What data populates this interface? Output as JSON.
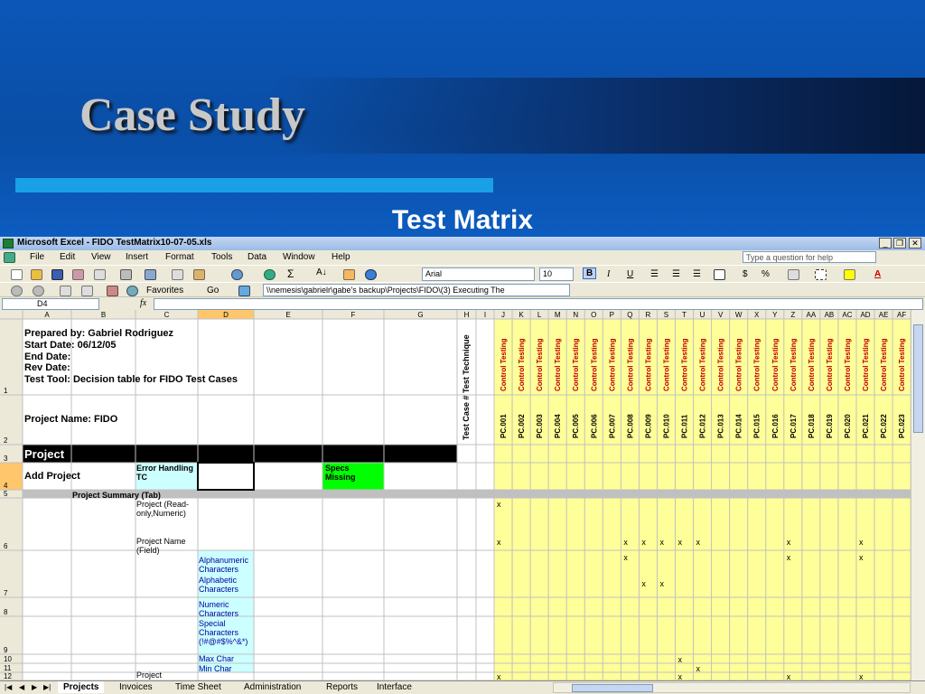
{
  "slide": {
    "title": "Case Study",
    "subtitle": "Test Matrix"
  },
  "window": {
    "title": "Microsoft Excel - FIDO  TestMatrix10-07-05.xls",
    "controls": [
      "_",
      "❐",
      "✕"
    ]
  },
  "menu": {
    "items": [
      "File",
      "Edit",
      "View",
      "Insert",
      "Format",
      "Tools",
      "Data",
      "Window",
      "Help"
    ],
    "question_placeholder": "Type a question for help"
  },
  "format_toolbar": {
    "font": "Arial",
    "size": "10",
    "bold": "B",
    "italic": "I",
    "underline": "U",
    "currency": "$",
    "percent": "%"
  },
  "web_toolbar": {
    "favorites": "Favorites",
    "go": "Go",
    "address": "\\\\nemesis\\gabrielr\\gabe's backup\\Projects\\FIDO\\(3) Executing The"
  },
  "formula_bar": {
    "name_box": "D4",
    "fx": "fx",
    "value": ""
  },
  "grid": {
    "left_columns": [
      "A",
      "B",
      "C",
      "D",
      "E",
      "F",
      "G",
      "H"
    ],
    "right_columns": [
      "I",
      "J",
      "K",
      "L",
      "M",
      "N",
      "O",
      "P",
      "Q",
      "R",
      "S",
      "T",
      "U",
      "V",
      "W",
      "X",
      "Y",
      "Z",
      "AA",
      "AB",
      "AC",
      "AD",
      "AE",
      "AF"
    ],
    "row_numbers": [
      "1",
      "2",
      "3",
      "4",
      "5",
      "6",
      "7",
      "8",
      "9",
      "10",
      "11",
      "12",
      "13"
    ],
    "header_lines": [
      "Prepared by: Gabriel Rodriguez",
      "Start Date: 06/12/05",
      "End Date:",
      "Rev Date:",
      "Test Tool: Decision table for FIDO Test Cases"
    ],
    "project_name": "Project Name: FIDO",
    "test_technique_label": "Test Technique",
    "test_case_label": "Test Case #",
    "technique_value": "Control Testing",
    "test_cases": [
      "PC.001",
      "PC.002",
      "PC.003",
      "PC.004",
      "PC.005",
      "PC.006",
      "PC.007",
      "PC.008",
      "PC.009",
      "PC.010",
      "PC.011",
      "PC.012",
      "PC.013",
      "PC.014",
      "PC.015",
      "PC.016",
      "PC.017",
      "PC.018",
      "PC.019",
      "PC.020",
      "PC.021",
      "PC.022",
      "PC.023"
    ],
    "project_header": "Project",
    "add_project": "Add Project",
    "error_handling": "Error Handling TC",
    "specs_missing": "Specs Missing",
    "summary_row": "Project Summary (Tab)",
    "field_project_readonly": "Project (Read-only,Numeric)",
    "field_project_name": "Project Name (Field)",
    "field_alphanumeric": "Alphanumeric Characters",
    "field_alphabetic": "Alphabetic Characters",
    "field_numeric": "Numeric Characters",
    "field_special": "Special Characters (!#@#$%^&*)",
    "field_max_char": "Max Char",
    "field_min_char": "Min Char",
    "field_project_last": "Project",
    "x_mark": "x",
    "colors": {
      "yellow": "#ffff99",
      "cyan": "#ccffff",
      "green": "#00ff00",
      "red_text": "#c00000",
      "header_bg": "#ece9d8",
      "selected_header": "#ffc66b"
    }
  },
  "sheet_tabs": [
    "Projects",
    "Invoices",
    "Time Sheet",
    "Administration",
    "Reports",
    "Interface"
  ]
}
